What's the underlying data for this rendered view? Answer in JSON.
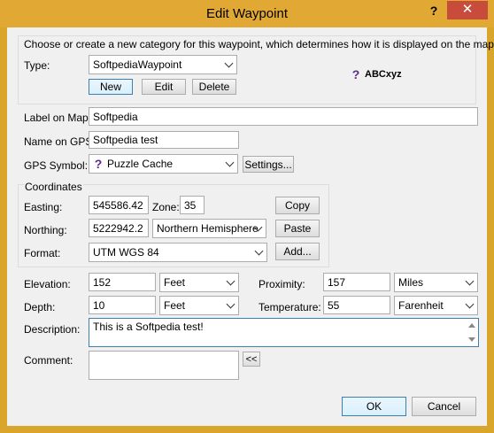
{
  "window": {
    "title": "Edit Waypoint",
    "help_glyph": "?",
    "close_glyph": "✕"
  },
  "category": {
    "instruction": "Choose or create a new category for this waypoint, which determines how it is displayed on the map",
    "type_label": "Type:",
    "type_value": "SoftpediaWaypoint",
    "new_label": "New",
    "edit_label": "Edit",
    "delete_label": "Delete",
    "preview_icon": "?",
    "preview_text": "ABCxyz"
  },
  "label_on_map": {
    "label": "Label on Map:",
    "value": "Softpedia"
  },
  "name_on_gps": {
    "label": "Name on GPS:",
    "value": "Softpedia test"
  },
  "gps_symbol": {
    "label": "GPS Symbol:",
    "icon": "?",
    "value": "Puzzle Cache",
    "settings_label": "Settings..."
  },
  "coordinates": {
    "group_label": "Coordinates",
    "easting_label": "Easting:",
    "easting_value": "545586.42",
    "zone_label": "Zone:",
    "zone_value": "35",
    "copy_label": "Copy",
    "northing_label": "Northing:",
    "northing_value": "5222942.2",
    "hemisphere_value": "Northern Hemisphere",
    "paste_label": "Paste",
    "format_label": "Format:",
    "format_value": "UTM WGS 84",
    "add_label": "Add..."
  },
  "elevation": {
    "label": "Elevation:",
    "value": "152",
    "unit": "Feet"
  },
  "depth": {
    "label": "Depth:",
    "value": "10",
    "unit": "Feet"
  },
  "proximity": {
    "label": "Proximity:",
    "value": "157",
    "unit": "Miles"
  },
  "temperature": {
    "label": "Temperature:",
    "value": "55",
    "unit": "Farenheit"
  },
  "description": {
    "label": "Description:",
    "value": "This is a Softpedia test!"
  },
  "comment": {
    "label": "Comment:",
    "value": "",
    "insert_label": "<<"
  },
  "footer": {
    "ok_label": "OK",
    "cancel_label": "Cancel"
  },
  "colors": {
    "title_bar": "#e1a934",
    "close_button": "#c74c3c",
    "dialog_bg": "#f0f0f0",
    "focus_border": "#3c7fb1"
  }
}
